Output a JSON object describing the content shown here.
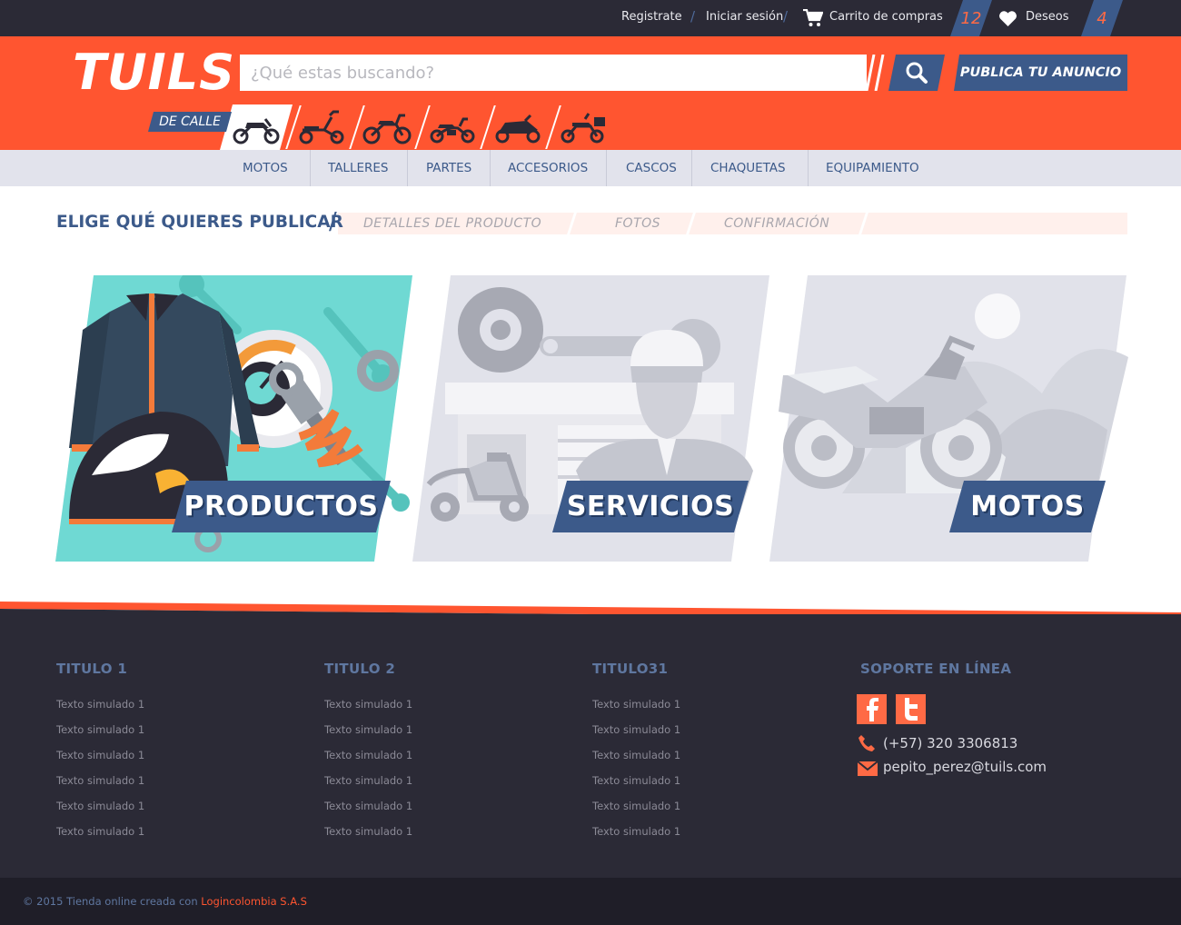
{
  "topbar": {
    "register": "Registrate",
    "login": "Iniciar sesión",
    "cart": "Carrito de compras",
    "cart_count": "12",
    "wishlist": "Deseos",
    "wishlist_count": "4"
  },
  "header": {
    "logo": "TUILS",
    "search_placeholder": "¿Qué estas buscando?",
    "publish_label": "PUBLICA TU ANUNCIO",
    "category_label": "DE CALLE",
    "categories": [
      {
        "icon": "street-motorcycle-icon",
        "active": true
      },
      {
        "icon": "scooter-icon",
        "active": false
      },
      {
        "icon": "dirt-bike-icon",
        "active": false
      },
      {
        "icon": "cruiser-motorcycle-icon",
        "active": false
      },
      {
        "icon": "sport-motorcycle-icon",
        "active": false
      },
      {
        "icon": "touring-motorcycle-icon",
        "active": false
      }
    ]
  },
  "nav": [
    "MOTOS",
    "TALLERES",
    "PARTES",
    "ACCESORIOS",
    "CASCOS",
    "CHAQUETAS",
    "EQUIPAMIENTO"
  ],
  "steps": {
    "title": "ELIGE QUÉ QUIERES PUBLICAR",
    "items": [
      "DETALLES DEL PRODUCTO",
      "FOTOS",
      "CONFIRMACIÓN"
    ]
  },
  "cards": [
    "PRODUCTOS",
    "SERVICIOS",
    "MOTOS"
  ],
  "footer": {
    "columns": [
      {
        "title": "TITULO 1",
        "links": [
          "Texto simulado 1",
          "Texto simulado 1",
          "Texto simulado 1",
          "Texto simulado 1",
          "Texto simulado 1",
          "Texto simulado 1"
        ]
      },
      {
        "title": "TITULO 2",
        "links": [
          "Texto simulado 1",
          "Texto simulado 1",
          "Texto simulado 1",
          "Texto simulado 1",
          "Texto simulado 1",
          "Texto simulado 1"
        ]
      },
      {
        "title": "TITULO31",
        "links": [
          "Texto simulado 1",
          "Texto simulado 1",
          "Texto simulado 1",
          "Texto simulado 1",
          "Texto simulado 1",
          "Texto simulado 1"
        ]
      }
    ],
    "support_title": "SOPORTE EN LÍNEA",
    "phone": "(+57) 320 3306813",
    "email": "pepito_perez@tuils.com",
    "copyright": "© 2015 Tienda online creada con",
    "copyright_brand": "Logincolombia S.A.S"
  },
  "colors": {
    "accent": "#ff5530",
    "primary": "#3c5a8a",
    "dark": "#2b2a36",
    "teal": "#6fd9d3"
  }
}
